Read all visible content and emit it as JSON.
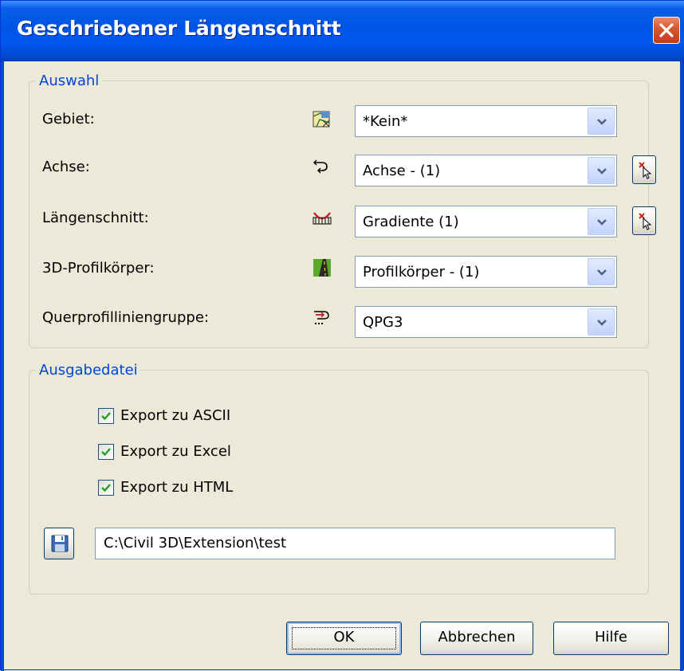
{
  "window": {
    "title": "Geschriebener Längenschnitt"
  },
  "selection_group": {
    "legend": "Auswahl",
    "rows": [
      {
        "label": "Gebiet:",
        "icon": "surface-icon",
        "value": "*Kein*",
        "has_pick": false
      },
      {
        "label": "Achse:",
        "icon": "alignment-icon",
        "value": "Achse - (1)",
        "has_pick": true
      },
      {
        "label": "Längenschnitt:",
        "icon": "profile-icon",
        "value": "Gradiente (1)",
        "has_pick": true
      },
      {
        "label": "3D-Profilkörper:",
        "icon": "corridor-icon",
        "value": "Profilkörper - (1)",
        "has_pick": false
      },
      {
        "label": "Querprofilliniengruppe:",
        "icon": "sample-line-group-icon",
        "value": "QPG3",
        "has_pick": false
      }
    ]
  },
  "output_group": {
    "legend": "Ausgabedatei",
    "checkboxes": [
      {
        "label": "Export zu ASCII",
        "checked": true
      },
      {
        "label": "Export zu Excel",
        "checked": true
      },
      {
        "label": "Export zu HTML",
        "checked": true
      }
    ],
    "path_value": "C:\\Civil 3D\\Extension\\test"
  },
  "buttons": {
    "ok": "OK",
    "cancel": "Abbrechen",
    "help": "Hilfe"
  },
  "colors": {
    "title_bar": "#0055E5",
    "accent_text": "#0046D5",
    "dialog_bg": "#ECE9D8",
    "close_red": "#D9532E",
    "check_green": "#21A121"
  }
}
